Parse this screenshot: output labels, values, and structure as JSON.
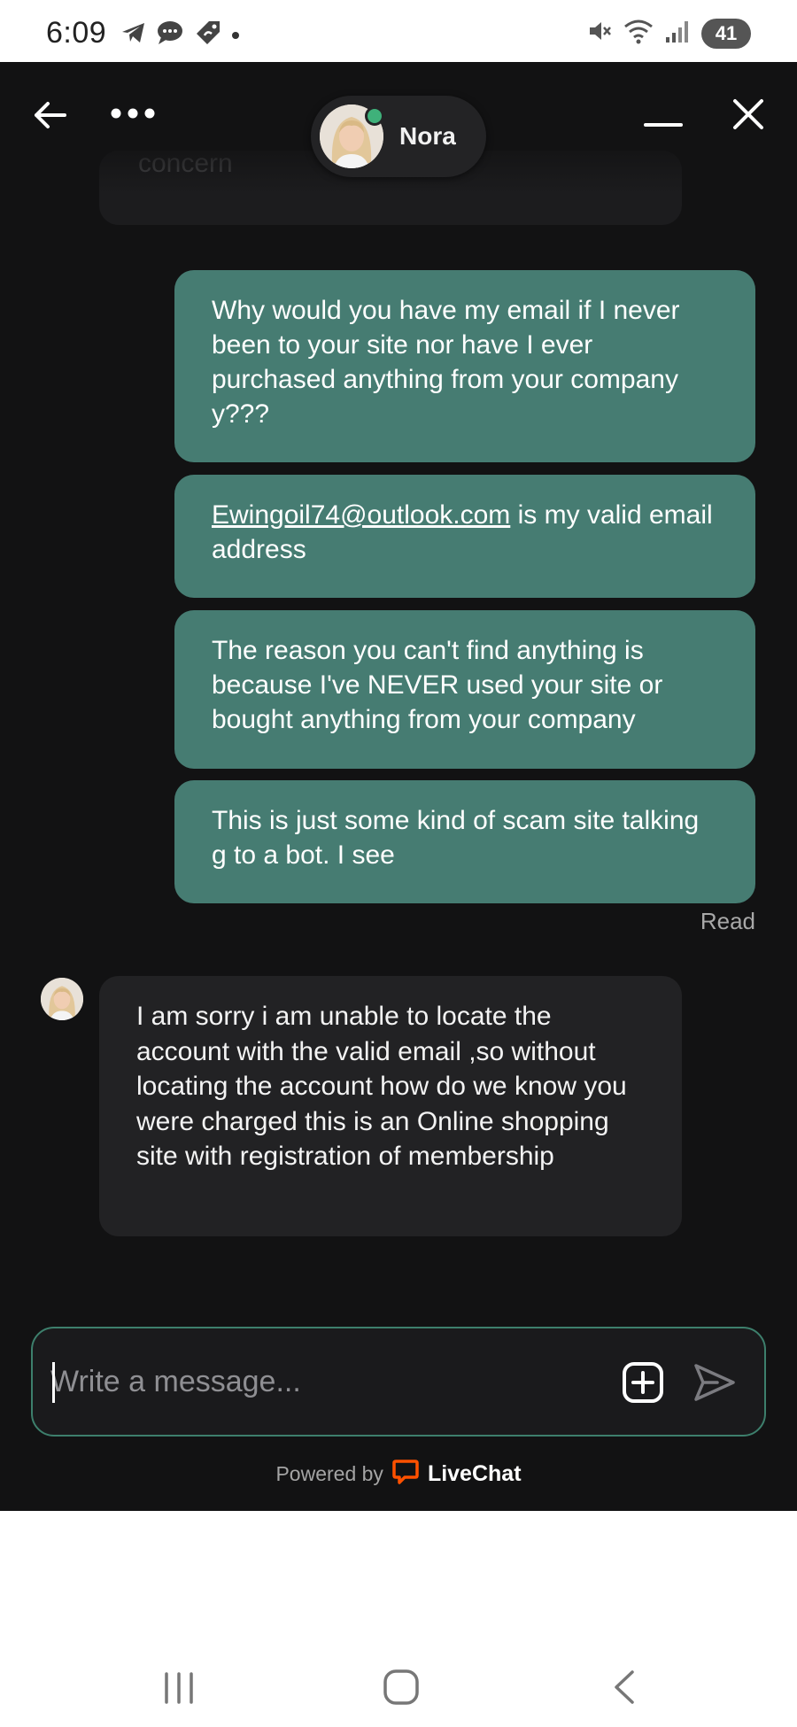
{
  "status_bar": {
    "time": "6:09",
    "battery": "41",
    "left_icons": [
      "telegram-icon",
      "chat-bubble-icon",
      "tag-icon"
    ],
    "right_icons": [
      "mute-icon",
      "wifi-icon",
      "signal-icon"
    ]
  },
  "header": {
    "agent_name": "Nora",
    "icons": [
      "back-arrow-icon",
      "more-icon",
      "minimize-icon",
      "close-icon"
    ]
  },
  "messages": {
    "previous_partial": "concern",
    "outgoing": [
      {
        "text": "Why would you have my email if I never been to your site nor have I ever purchased anything from your company y???"
      },
      {
        "link": "Ewingoil74@outlook.com",
        "text": " is my valid email address"
      },
      {
        "text": "The reason you can't find anything is because I've NEVER used your site or bought anything from your company"
      },
      {
        "text": "This is just some kind of scam site talking g to a bot. I see"
      }
    ],
    "read_status": "Read",
    "incoming": [
      {
        "text": "I am sorry i am unable to locate the account with the valid email ,so without locating the account how do we know you were charged this is an Online shopping site with registration of membership"
      }
    ]
  },
  "composer": {
    "placeholder": "Write a message...",
    "value": ""
  },
  "footer": {
    "powered_by": "Powered by",
    "brand": "LiveChat",
    "brand_color": "#ff5100"
  },
  "colors": {
    "background": "#121213",
    "outgoing_bubble": "#467c72",
    "incoming_bubble": "#222224",
    "composer_border": "#3d7f6c",
    "online": "#3fb17a"
  },
  "nav_bar": {
    "icons": [
      "recent-apps-icon",
      "home-icon",
      "back-icon"
    ]
  }
}
